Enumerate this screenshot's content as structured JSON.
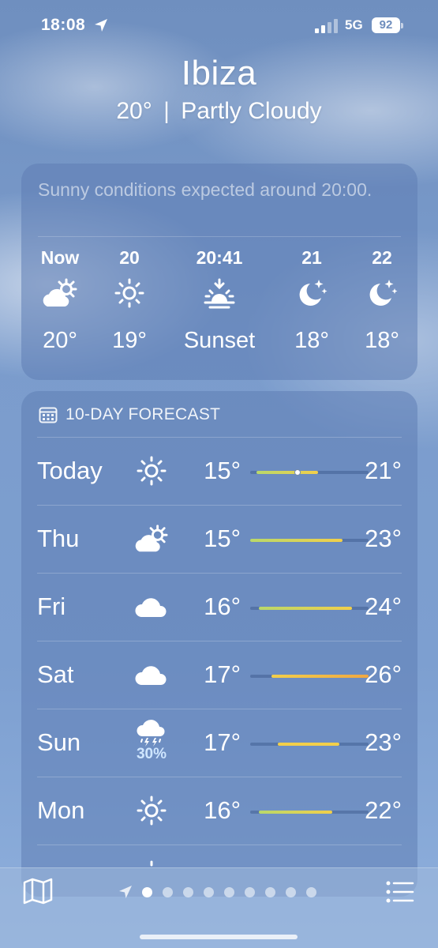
{
  "status_bar": {
    "time": "18:08",
    "network": "5G",
    "battery": "92"
  },
  "header": {
    "city": "Ibiza",
    "temp": "20°",
    "separator": "|",
    "condition": "Partly Cloudy"
  },
  "hourly": {
    "summary": "Sunny conditions expected around 20:00.",
    "items": [
      {
        "label": "Now",
        "icon": "partly-cloudy-icon",
        "temp": "20°"
      },
      {
        "label": "20",
        "icon": "sun-icon",
        "temp": "19°"
      },
      {
        "label": "20:41",
        "icon": "sunset-icon",
        "temp": "Sunset"
      },
      {
        "label": "21",
        "icon": "moon-stars-icon",
        "temp": "18°"
      },
      {
        "label": "22",
        "icon": "moon-stars-icon",
        "temp": "18°"
      }
    ]
  },
  "forecast": {
    "title": "10-DAY FORECAST",
    "days": [
      {
        "day": "Today",
        "icon": "sun-icon",
        "precip": "",
        "low": "15°",
        "high": "21°",
        "bar_start": 0.05,
        "bar_end": 0.57,
        "current": 0.4
      },
      {
        "day": "Thu",
        "icon": "partly-cloudy-icon",
        "precip": "",
        "low": "15°",
        "high": "23°",
        "bar_start": 0.0,
        "bar_end": 0.78
      },
      {
        "day": "Fri",
        "icon": "cloud-icon",
        "precip": "",
        "low": "16°",
        "high": "24°",
        "bar_start": 0.07,
        "bar_end": 0.86
      },
      {
        "day": "Sat",
        "icon": "cloud-icon",
        "precip": "",
        "low": "17°",
        "high": "26°",
        "bar_start": 0.18,
        "bar_end": 1.0
      },
      {
        "day": "Sun",
        "icon": "thunderstorm-icon",
        "precip": "30%",
        "low": "17°",
        "high": "23°",
        "bar_start": 0.23,
        "bar_end": 0.75
      },
      {
        "day": "Mon",
        "icon": "sun-icon",
        "precip": "",
        "low": "16°",
        "high": "22°",
        "bar_start": 0.07,
        "bar_end": 0.69
      }
    ]
  },
  "bottom_bar": {
    "page_count": 9,
    "active_page": 0
  },
  "colors": {
    "bar_green": "#b9d86a",
    "bar_yellow": "#f2cf4a",
    "bar_orange": "#f0a742"
  }
}
